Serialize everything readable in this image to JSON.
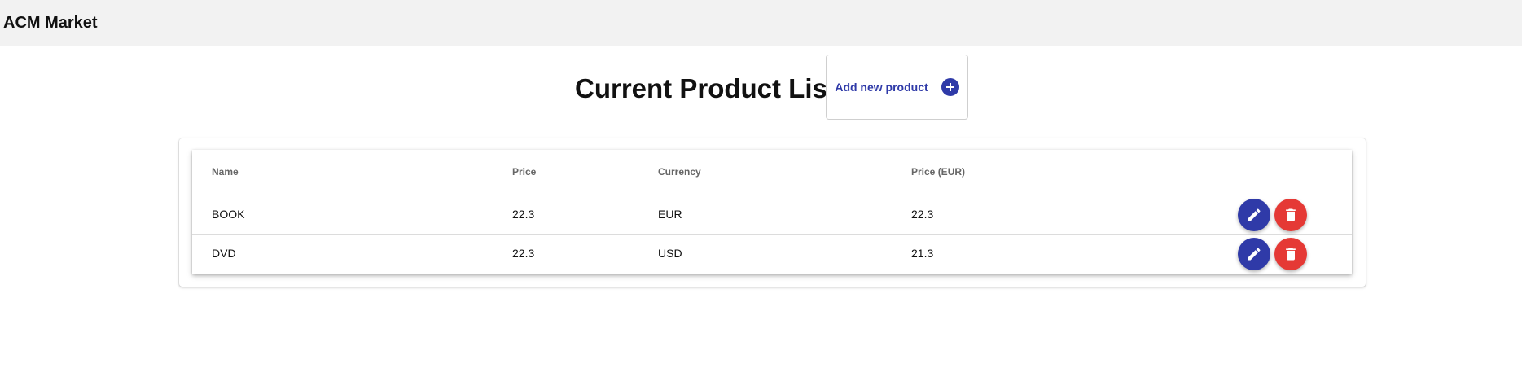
{
  "app": {
    "title": "ACM Market"
  },
  "page": {
    "title": "Current Product List"
  },
  "add_button": {
    "label": "Add new product",
    "icon": "plus-circle-icon"
  },
  "table": {
    "columns": [
      "Name",
      "Price",
      "Currency",
      "Price (EUR)"
    ],
    "rows": [
      {
        "name": "BOOK",
        "price": "22.3",
        "currency": "EUR",
        "price_eur": "22.3"
      },
      {
        "name": "DVD",
        "price": "22.3",
        "currency": "USD",
        "price_eur": "21.3"
      }
    ],
    "row_actions": {
      "edit_icon": "pencil-icon",
      "delete_icon": "trash-icon"
    }
  },
  "colors": {
    "primary": "#2f3aa8",
    "danger": "#e53935",
    "appbar": "#f2f2f2"
  }
}
